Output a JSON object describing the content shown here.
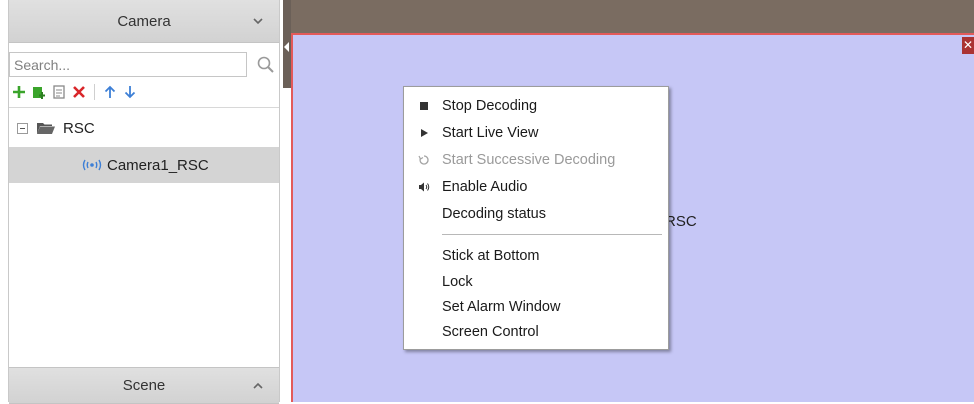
{
  "left_panel": {
    "camera_header": "Camera",
    "scene_header": "Scene",
    "search": {
      "placeholder": "Search...",
      "value": ""
    },
    "toolbar_icons": [
      "add-icon",
      "add-group-icon",
      "edit-icon",
      "delete-icon",
      "move-up-icon",
      "move-down-icon"
    ],
    "tree": {
      "root_label": "RSC",
      "items": [
        {
          "label": "Camera1_RSC"
        }
      ]
    }
  },
  "video_pane": {
    "label_fragment": "RSC",
    "close_glyph": "✕",
    "background": "#c6c7f6",
    "border_color": "#e35a5a"
  },
  "context_menu": {
    "items": [
      {
        "label": "Stop Decoding",
        "icon": "stop-icon",
        "enabled": true
      },
      {
        "label": "Start Live View",
        "icon": "play-icon",
        "enabled": true
      },
      {
        "label": "Start Successive Decoding",
        "icon": "cycle-icon",
        "enabled": false
      },
      {
        "label": "Enable Audio",
        "icon": "audio-icon",
        "enabled": true
      },
      {
        "label": "Decoding status",
        "icon": "",
        "enabled": true
      },
      {
        "label": "Stick at Bottom",
        "icon": "",
        "enabled": true
      },
      {
        "label": "Lock",
        "icon": "",
        "enabled": true
      },
      {
        "label": "Set Alarm Window",
        "icon": "",
        "enabled": true
      },
      {
        "label": "Screen Control",
        "icon": "",
        "enabled": true
      }
    ]
  },
  "colors": {
    "top_strip": "#7a6c61",
    "selected_row": "#d4d4d4",
    "add_green": "#3aa42b",
    "delete_red": "#d9262a",
    "arrow_blue": "#3d7fd6"
  }
}
